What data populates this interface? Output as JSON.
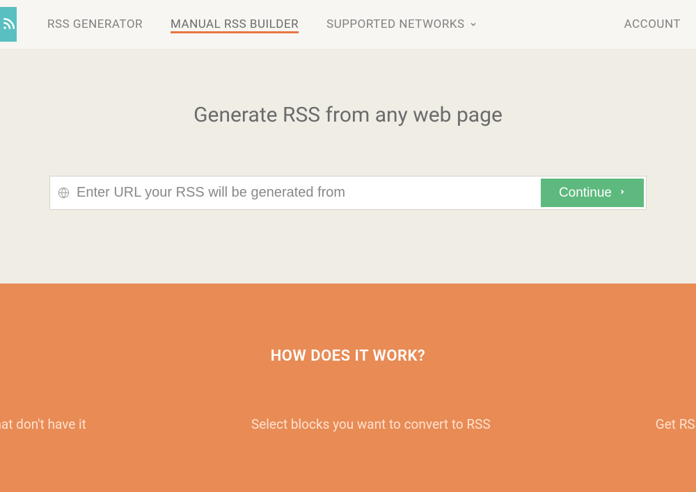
{
  "nav": {
    "items": [
      {
        "label": "RSS GENERATOR"
      },
      {
        "label": "MANUAL RSS BUILDER"
      },
      {
        "label": "SUPPORTED NETWORKS"
      }
    ],
    "account": "ACCOUNT"
  },
  "hero": {
    "title": "Generate RSS from any web page",
    "placeholder": "Enter URL your RSS will be generated from",
    "button": "Continue"
  },
  "how": {
    "title": "HOW DOES IT WORK?",
    "step1": "sites that don't have it",
    "step2": "Select blocks you want to convert to RSS",
    "step3": "Get RSS"
  }
}
